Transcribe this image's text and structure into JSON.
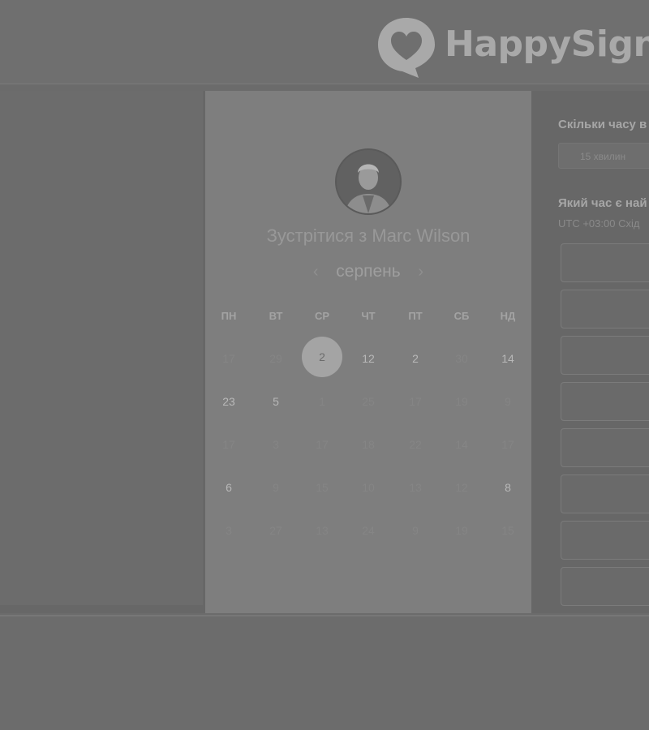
{
  "brand": {
    "name": "HappySigna"
  },
  "calendar": {
    "title": "Зустрітися з Marc Wilson",
    "month": "серпень",
    "prev_icon": "‹",
    "next_icon": "›",
    "weekdays": [
      "ПН",
      "ВТ",
      "СР",
      "ЧТ",
      "ПТ",
      "СБ",
      "НД"
    ],
    "weeks": [
      [
        {
          "d": "17",
          "s": "dim"
        },
        {
          "d": "29",
          "s": "dim"
        },
        {
          "d": "2",
          "s": "selected"
        },
        {
          "d": "12",
          "s": "active"
        },
        {
          "d": "2",
          "s": "active"
        },
        {
          "d": "30",
          "s": "dim"
        },
        {
          "d": "14",
          "s": "active"
        }
      ],
      [
        {
          "d": "23",
          "s": "active"
        },
        {
          "d": "5",
          "s": "active"
        },
        {
          "d": "1",
          "s": "dim"
        },
        {
          "d": "25",
          "s": "dim"
        },
        {
          "d": "17",
          "s": "dim"
        },
        {
          "d": "19",
          "s": "dim"
        },
        {
          "d": "9",
          "s": "dim"
        }
      ],
      [
        {
          "d": "17",
          "s": "dim"
        },
        {
          "d": "3",
          "s": "dim"
        },
        {
          "d": "17",
          "s": "dim"
        },
        {
          "d": "18",
          "s": "dim"
        },
        {
          "d": "22",
          "s": "dim"
        },
        {
          "d": "14",
          "s": "dim"
        },
        {
          "d": "17",
          "s": "dim"
        }
      ],
      [
        {
          "d": "6",
          "s": "active"
        },
        {
          "d": "9",
          "s": "dim"
        },
        {
          "d": "15",
          "s": "dim"
        },
        {
          "d": "10",
          "s": "dim"
        },
        {
          "d": "13",
          "s": "dim"
        },
        {
          "d": "12",
          "s": "dim"
        },
        {
          "d": "8",
          "s": "active"
        }
      ],
      [
        {
          "d": "3",
          "s": "dim"
        },
        {
          "d": "27",
          "s": "dim"
        },
        {
          "d": "13",
          "s": "dim"
        },
        {
          "d": "24",
          "s": "dim"
        },
        {
          "d": "9",
          "s": "dim"
        },
        {
          "d": "19",
          "s": "dim"
        },
        {
          "d": "15",
          "s": "dim"
        }
      ]
    ]
  },
  "scheduler": {
    "duration_label": "Скільки часу в",
    "duration_value": "15 хвилин",
    "time_label": "Який час є най",
    "timezone": "UTC +03:00 Схід"
  }
}
